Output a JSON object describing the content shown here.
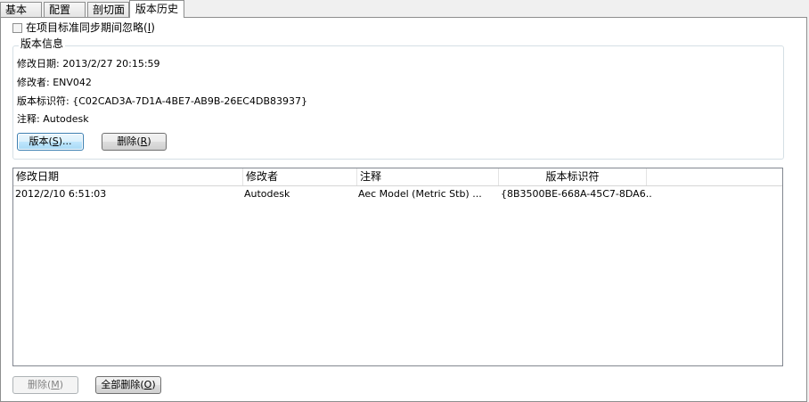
{
  "tabs": [
    "基本",
    "配置",
    "剖切面",
    "版本历史"
  ],
  "ignore_checkbox": {
    "label": "在项目标准同步期间忽略",
    "mnemonic": "I",
    "checked": false
  },
  "version_info": {
    "legend": "版本信息",
    "modified_date_label": "修改日期:",
    "modified_date_value": "2013/2/27 20:15:59",
    "modifier_label": "修改者:",
    "modifier_value": "ENV042",
    "version_id_label": "版本标识符:",
    "version_id_value": "{C02CAD3A-7D1A-4BE7-AB9B-26EC4DB83937}",
    "comment_label": "注释:",
    "comment_value": "Autodesk",
    "version_button": {
      "label": "版本",
      "mnemonic": "S",
      "suffix": "..."
    },
    "delete_button": {
      "label": "删除",
      "mnemonic": "R"
    }
  },
  "history_table": {
    "columns": [
      "修改日期",
      "修改者",
      "注释",
      "版本标识符"
    ],
    "rows": [
      {
        "date": "2012/2/10 6:51:03",
        "modifier": "Autodesk",
        "comment": "Aec Model (Metric Stb) ...",
        "version_id": "{8B3500BE-668A-45C7-8DA6..."
      }
    ]
  },
  "footer": {
    "delete_button": {
      "label": "删除",
      "mnemonic": "M",
      "enabled": false
    },
    "delete_all_button": {
      "label": "全部删除",
      "mnemonic": "O"
    }
  }
}
